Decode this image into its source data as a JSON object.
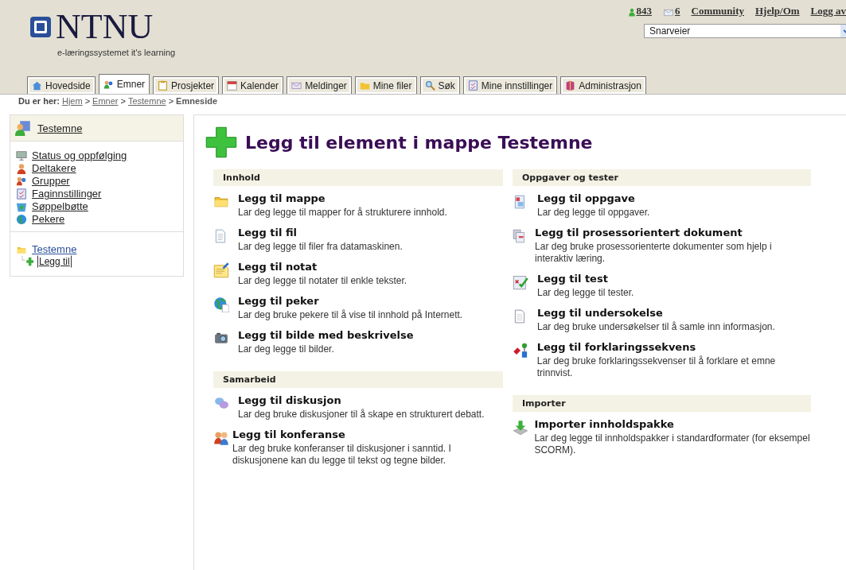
{
  "header": {
    "logo": "NTNU",
    "tagline": "e-læringssystemet it's learning",
    "online_count": "843",
    "message_count": "6",
    "links": [
      "Community",
      "Hjelp/Om",
      "Logg av"
    ],
    "shortcuts": {
      "value": "Snarveier"
    }
  },
  "tabs": [
    {
      "label": "Hovedside",
      "selected": false
    },
    {
      "label": "Emner",
      "selected": true
    },
    {
      "label": "Prosjekter",
      "selected": false
    },
    {
      "label": "Kalender",
      "selected": false
    },
    {
      "label": "Meldinger",
      "selected": false
    },
    {
      "label": "Mine filer",
      "selected": false
    },
    {
      "label": "Søk",
      "selected": false
    },
    {
      "label": "Mine innstillinger",
      "selected": false
    },
    {
      "label": "Administrasjon",
      "selected": false
    }
  ],
  "breadcrumb": {
    "label": "Du er her:",
    "separator": ">",
    "items": [
      {
        "text": "Hjem",
        "link": true
      },
      {
        "text": "Emner",
        "link": true
      },
      {
        "text": "Testemne",
        "link": true
      },
      {
        "text": "Emneside",
        "link": false
      }
    ]
  },
  "sidebar": {
    "title": "Testemne",
    "items": [
      "Status og oppfølging",
      "Deltakere",
      "Grupper",
      "Faginnstillinger",
      "Søppelbøtte",
      "Pekere"
    ],
    "tree": {
      "label": "Testemne",
      "children": [
        {
          "label": "Legg til",
          "selected": true
        }
      ]
    }
  },
  "main": {
    "title": "Legg til element i mappe Testemne",
    "columns": [
      [
        {
          "heading": "Innhold",
          "items": [
            {
              "title": "Legg til mappe",
              "description": "Lar deg legge til mapper for å strukturere innhold."
            },
            {
              "title": "Legg til fil",
              "description": "Lar deg legge til filer fra datamaskinen."
            },
            {
              "title": "Legg til notat",
              "description": "Lar deg legge til notater til enkle tekster."
            },
            {
              "title": "Legg til peker",
              "description": "Lar deg bruke pekere til å vise til innhold på Internett."
            },
            {
              "title": "Legg til bilde med beskrivelse",
              "description": "Lar deg legge til bilder."
            }
          ]
        },
        {
          "heading": "Samarbeid",
          "items": [
            {
              "title": "Legg til diskusjon",
              "description": "Lar deg bruke diskusjoner til å skape en strukturert debatt."
            },
            {
              "title": "Legg til konferanse",
              "description": "Lar deg bruke konferanser til diskusjoner i sanntid. I diskusjonene kan du legge til tekst og tegne bilder."
            }
          ]
        }
      ],
      [
        {
          "heading": "Oppgaver og tester",
          "items": [
            {
              "title": "Legg til oppgave",
              "description": "Lar deg legge til oppgaver."
            },
            {
              "title": "Legg til prosessorientert dokument",
              "description": "Lar deg bruke prosessorienterte dokumenter som hjelp i interaktiv læring."
            },
            {
              "title": "Legg til test",
              "description": "Lar deg legge til tester."
            },
            {
              "title": "Legg til undersokelse",
              "description": "Lar deg bruke undersøkelser til å samle inn informasjon."
            },
            {
              "title": "Legg til forklaringssekvens",
              "description": "Lar deg bruke forklaringssekvenser til å forklare et emne trinnvist."
            }
          ]
        },
        {
          "heading": "Importer",
          "items": [
            {
              "title": "Importer innholdspakke",
              "description": "Lar deg legge til innholdspakker i standardformater (for eksempel SCORM)."
            }
          ]
        }
      ]
    ]
  }
}
